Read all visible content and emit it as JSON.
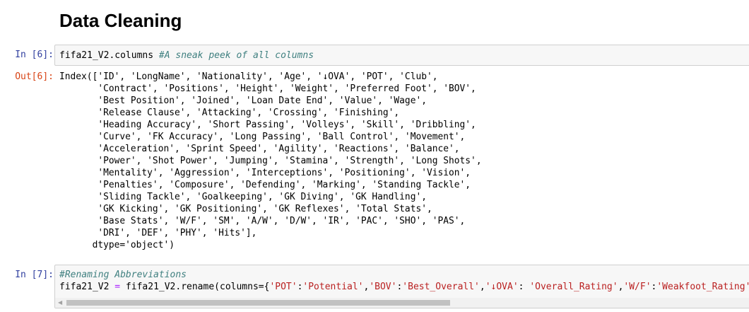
{
  "heading": "Data Cleaning",
  "cell6": {
    "in_prompt": "In [6]:",
    "code": "fifa21_V2.columns",
    "comment": "#A sneak peek of all columns",
    "out_prompt": "Out[6]:",
    "output": "Index(['ID', 'LongName', 'Nationality', 'Age', '↓OVA', 'POT', 'Club',\n       'Contract', 'Positions', 'Height', 'Weight', 'Preferred Foot', 'BOV',\n       'Best Position', 'Joined', 'Loan Date End', 'Value', 'Wage',\n       'Release Clause', 'Attacking', 'Crossing', 'Finishing',\n       'Heading Accuracy', 'Short Passing', 'Volleys', 'Skill', 'Dribbling',\n       'Curve', 'FK Accuracy', 'Long Passing', 'Ball Control', 'Movement',\n       'Acceleration', 'Sprint Speed', 'Agility', 'Reactions', 'Balance',\n       'Power', 'Shot Power', 'Jumping', 'Stamina', 'Strength', 'Long Shots',\n       'Mentality', 'Aggression', 'Interceptions', 'Positioning', 'Vision',\n       'Penalties', 'Composure', 'Defending', 'Marking', 'Standing Tackle',\n       'Sliding Tackle', 'Goalkeeping', 'GK Diving', 'GK Handling',\n       'GK Kicking', 'GK Positioning', 'GK Reflexes', 'Total Stats',\n       'Base Stats', 'W/F', 'SM', 'A/W', 'D/W', 'IR', 'PAC', 'SHO', 'PAS',\n       'DRI', 'DEF', 'PHY', 'Hits'],\n      dtype='object')"
  },
  "cell7": {
    "in_prompt": "In [7]:",
    "comment": "#Renaming Abbreviations",
    "code_start": "fifa21_V2 ",
    "code_eq": "=",
    "code_call": " fifa21_V2.rename(columns={",
    "s1": "'POT'",
    "s2": "'Potential'",
    "s3": "'BOV'",
    "s4": "'Best_Overall'",
    "s5": "'↓OVA'",
    "s6": "'Overall_Rating'",
    "s7": "'W/F'",
    "s8": "'Weakfoot_Rating'",
    "s9": "'",
    "colon": ":",
    "comma": ",",
    "colon_space": ": "
  },
  "scroll_arrow": "◀"
}
